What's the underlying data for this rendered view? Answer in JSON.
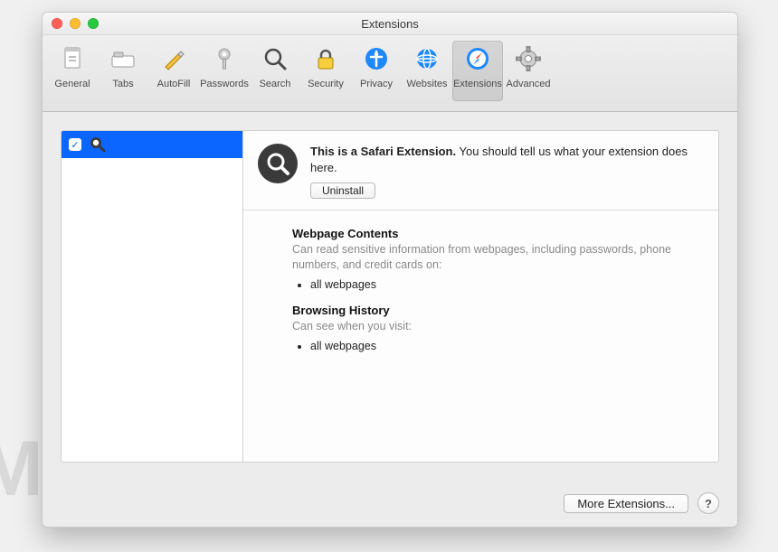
{
  "window": {
    "title": "Extensions"
  },
  "toolbar": {
    "items": [
      {
        "label": "General"
      },
      {
        "label": "Tabs"
      },
      {
        "label": "AutoFill"
      },
      {
        "label": "Passwords"
      },
      {
        "label": "Search"
      },
      {
        "label": "Security"
      },
      {
        "label": "Privacy"
      },
      {
        "label": "Websites"
      },
      {
        "label": "Extensions"
      },
      {
        "label": "Advanced"
      }
    ],
    "selected_index": 8
  },
  "sidebar": {
    "items": [
      {
        "checked": true,
        "icon": "magnifier"
      }
    ]
  },
  "detail": {
    "title_prefix": "This is a Safari Extension.",
    "title_rest": " You should tell us what your extension does here.",
    "uninstall_label": "Uninstall",
    "perm1_heading": "Webpage Contents",
    "perm1_text": "Can read sensitive information from webpages, including passwords, phone numbers, and credit cards on:",
    "perm1_bullet": "all webpages",
    "perm2_heading": "Browsing History",
    "perm2_text": "Can see when you visit:",
    "perm2_bullet": "all webpages"
  },
  "footer": {
    "more_label": "More Extensions...",
    "help_label": "?"
  },
  "watermark": "MALWARETIPS"
}
